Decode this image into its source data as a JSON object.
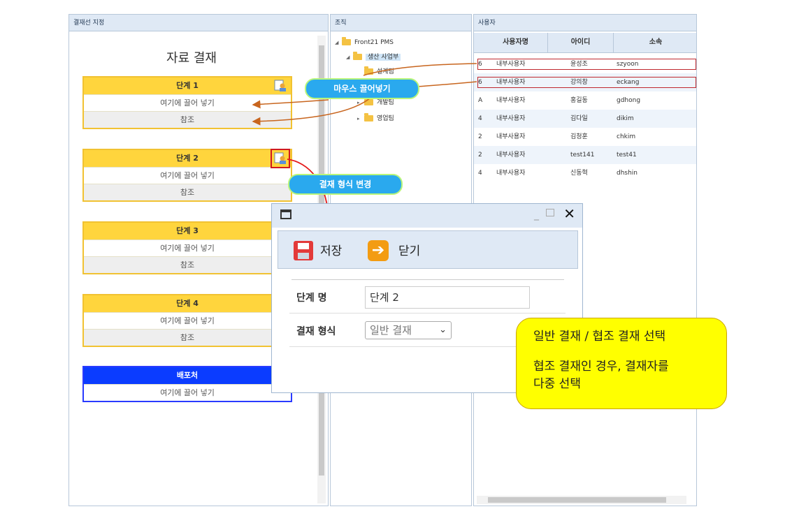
{
  "left_panel": {
    "header": "결재선 지정",
    "doc_title": "자료 결재",
    "stages": [
      {
        "title": "단계 1",
        "drop": "여기에 끌어 넣기",
        "ref": "참조"
      },
      {
        "title": "단계 2",
        "drop": "여기에 끌어 넣기",
        "ref": "참조"
      },
      {
        "title": "단계 3",
        "drop": "여기에 끌어 넣기",
        "ref": "참조"
      },
      {
        "title": "단계 4",
        "drop": "여기에 끌어 넣기",
        "ref": "참조"
      }
    ],
    "distribution": {
      "title": "배포처",
      "drop": "여기에 끌어 넣기"
    }
  },
  "mid_panel": {
    "header": "조직",
    "tree": [
      "Front21 PMS",
      "생산 사업부",
      "설계팀",
      "부",
      "개발팀",
      "영업팀"
    ]
  },
  "right_panel": {
    "header": "사용자",
    "columns": [
      "사용자명",
      "아이디",
      "소속"
    ],
    "rows": [
      {
        "num": "6",
        "type": "내부사용자",
        "name": "윤성조",
        "id": "szyoon"
      },
      {
        "num": "6",
        "type": "내부사용자",
        "name": "강의창",
        "id": "eckang"
      },
      {
        "num": "A",
        "type": "내부사용자",
        "name": "홍길동",
        "id": "gdhong"
      },
      {
        "num": "4",
        "type": "내부사용자",
        "name": "김다일",
        "id": "dikim"
      },
      {
        "num": "2",
        "type": "내부사용자",
        "name": "김청훈",
        "id": "chkim"
      },
      {
        "num": "2",
        "type": "내부사용자",
        "name": "test141",
        "id": "test41"
      },
      {
        "num": "4",
        "type": "내부사용자",
        "name": "신동혁",
        "id": "dhshin"
      }
    ]
  },
  "callouts": {
    "drag": "마우스 끌어넣기",
    "change": "결재 형식 변경"
  },
  "dialog": {
    "save": "저장",
    "close": "닫기",
    "stage_label": "단계 명",
    "stage_value": "단계 2",
    "type_label": "결재 형식",
    "type_value": "일반 결재"
  },
  "note": {
    "line1": "일반 결재 / 협조 결재 선택",
    "line2": "협조 결재인 경우, 결재자를",
    "line3": "다중 선택"
  },
  "colors": {
    "stage_header": "#ffd53d",
    "distribution_header": "#0b3cff",
    "callout_blue": "#2aa9ee",
    "note_yellow": "#ffff00",
    "highlight_red": "#c0282e"
  }
}
